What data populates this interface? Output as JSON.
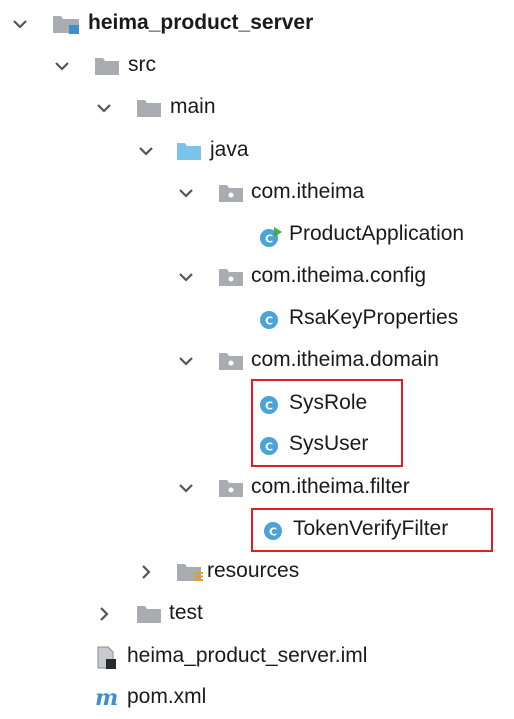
{
  "tree": {
    "root": {
      "label": "heima_product_server",
      "expanded": true
    },
    "src": {
      "label": "src",
      "expanded": true
    },
    "main": {
      "label": "main",
      "expanded": true
    },
    "java": {
      "label": "java",
      "expanded": true
    },
    "pkg_itheima": {
      "label": "com.itheima",
      "expanded": true
    },
    "product_application": {
      "label": "ProductApplication",
      "icon": "spring-boot-class-icon"
    },
    "pkg_config": {
      "label": "com.itheima.config",
      "expanded": true
    },
    "rsa_key_properties": {
      "label": "RsaKeyProperties",
      "icon": "class-icon"
    },
    "pkg_domain": {
      "label": "com.itheima.domain",
      "expanded": true
    },
    "sys_role": {
      "label": "SysRole",
      "icon": "class-icon"
    },
    "sys_user": {
      "label": "SysUser",
      "icon": "class-icon"
    },
    "pkg_filter": {
      "label": "com.itheima.filter",
      "expanded": true
    },
    "token_verify_filter": {
      "label": "TokenVerifyFilter",
      "icon": "class-icon"
    },
    "resources": {
      "label": "resources",
      "expanded": false
    },
    "test": {
      "label": "test",
      "expanded": false
    },
    "iml_file": {
      "label": "heima_product_server.iml",
      "icon": "module-file-icon"
    },
    "pom_file": {
      "label": "pom.xml",
      "icon": "maven-icon"
    }
  },
  "colors": {
    "highlight_border": "#e02020",
    "folder_gray": "#a9adb2",
    "folder_blue": "#79c3ec",
    "class_circle": "#4ba3d8",
    "maven_m": "#3e8fd0"
  }
}
